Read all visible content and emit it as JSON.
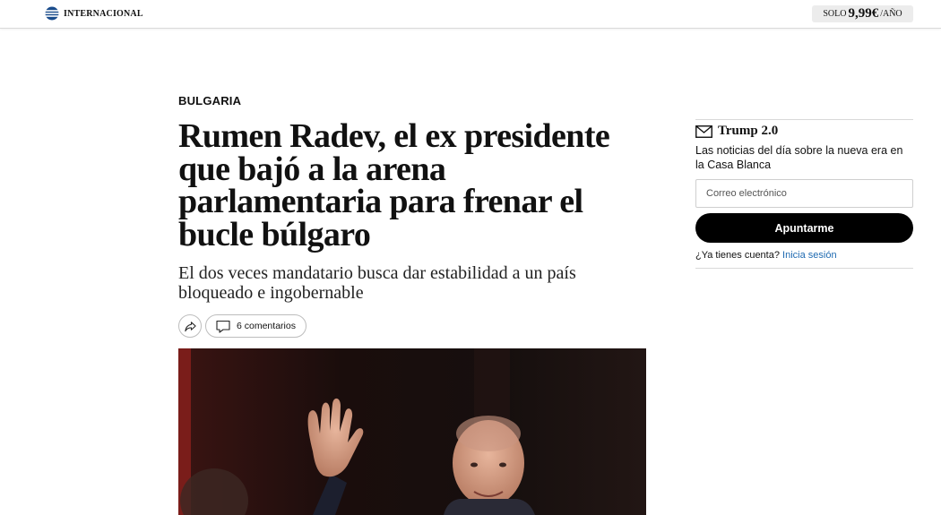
{
  "header": {
    "section_name": "INTERNACIONAL",
    "subscribe_prefix": "SOLO",
    "subscribe_price": "9,99€",
    "subscribe_suffix": "/AÑO"
  },
  "article": {
    "kicker": "BULGARIA",
    "headline": "Rumen Radev, el ex presidente que bajó a la arena parlamentaria para frenar el bucle búlgaro",
    "subheadline": "El dos veces mandatario busca dar estabilidad a un país bloqueado e ingobernable",
    "comments_label": "6 comentarios",
    "share_icon": "share-icon",
    "comment_icon": "comment-icon"
  },
  "newsletter": {
    "icon": "envelope-icon",
    "title": "Trump 2.0",
    "description": "Las noticias del día sobre la nueva era en la Casa Blanca",
    "email_placeholder": "Correo electrónico",
    "submit_label": "Apuntarme",
    "login_prompt": "¿Ya tienes cuenta?",
    "login_link": "Inicia sesión"
  }
}
